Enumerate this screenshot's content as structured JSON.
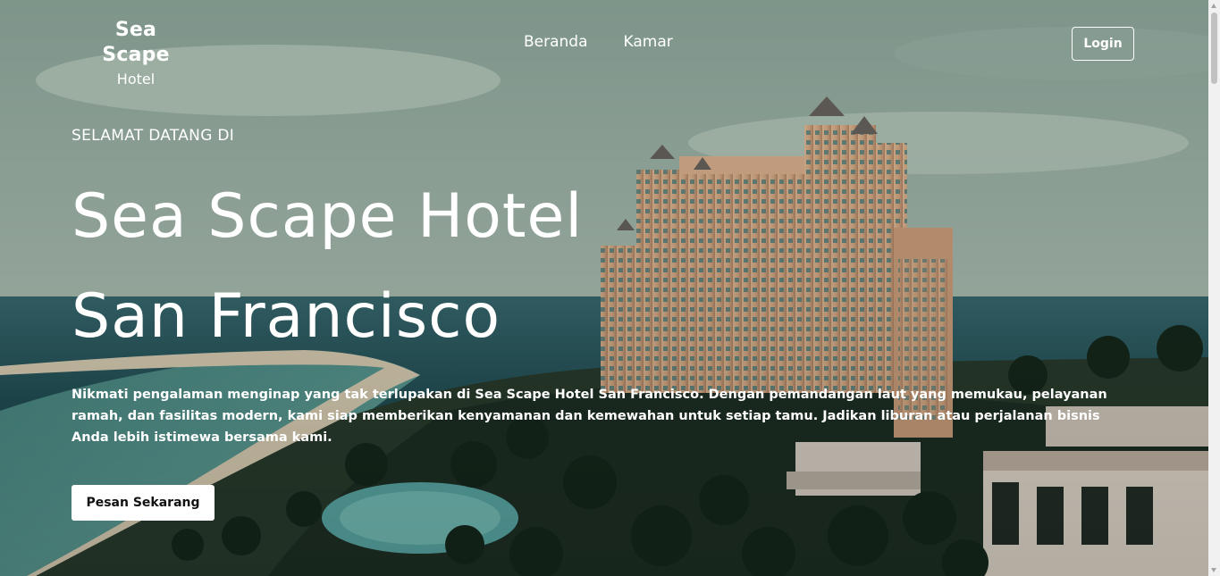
{
  "brand": {
    "name": "Sea Scape",
    "subtitle": "Hotel"
  },
  "nav": {
    "items": [
      {
        "label": "Beranda"
      },
      {
        "label": "Kamar"
      }
    ]
  },
  "header": {
    "login_label": "Login"
  },
  "hero": {
    "welcome": "SELAMAT DATANG DI",
    "title_line1": "Sea Scape Hotel",
    "title_line2": "San Francisco",
    "description": "Nikmati pengalaman menginap yang tak terlupakan di Sea Scape Hotel San Francisco. Dengan pemandangan laut yang memukau, pelayanan ramah, dan fasilitas modern, kami siap memberikan kenyamanan dan kemewahan untuk setiap tamu. Jadikan liburan atau perjalanan bisnis Anda lebih istimewa bersama kami.",
    "cta_label": "Pesan Sekarang"
  },
  "colors": {
    "sky": "#a9c4b9",
    "sea": "#2f6d6e",
    "hotel": "#e3b48f",
    "foliage": "#1f3326",
    "text": "#ffffff"
  }
}
